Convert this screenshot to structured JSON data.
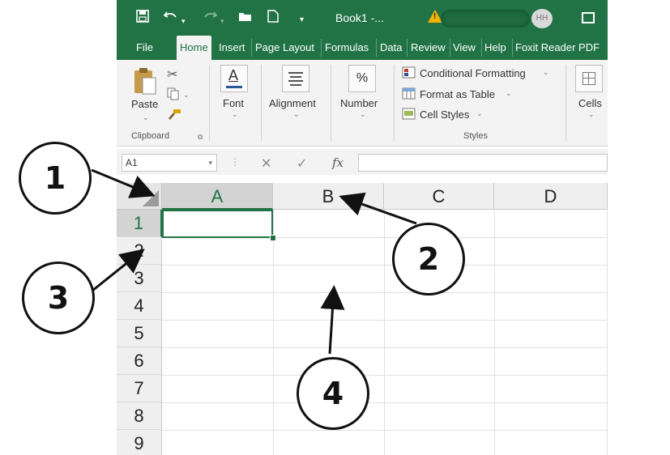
{
  "titlebar": {
    "title": "Book1 -...",
    "avatar_initials": "HH",
    "icons": [
      "save-icon",
      "undo-icon",
      "redo-icon",
      "open-folder-icon",
      "new-file-icon",
      "customize-icon",
      "warning-icon",
      "restore-icon"
    ]
  },
  "ribbon_tabs": [
    "File",
    "Home",
    "Insert",
    "Page Layout",
    "Formulas",
    "Data",
    "Review",
    "View",
    "Help",
    "Foxit Reader PDF"
  ],
  "active_tab": "Home",
  "ribbon": {
    "paste": "Paste",
    "clipboard": "Clipboard",
    "font": "Font",
    "alignment": "Alignment",
    "number": "Number",
    "number_icon": "%",
    "conditional_formatting": "Conditional Formatting",
    "format_as_table": "Format as Table",
    "cell_styles": "Cell Styles",
    "styles": "Styles",
    "cells": "Cells"
  },
  "formula_bar": {
    "name_box": "A1",
    "cancel": "✕",
    "enter": "✓",
    "fx": "fx"
  },
  "sheet": {
    "columns": [
      "A",
      "B",
      "C",
      "D"
    ],
    "rows": [
      "1",
      "2",
      "3",
      "4",
      "5",
      "6",
      "7",
      "8",
      "9"
    ],
    "active_cell": "A1"
  },
  "callouts": [
    "1",
    "2",
    "3",
    "4"
  ],
  "colors": {
    "excel_green": "#217346",
    "ribbon_bg": "#f3f3f3",
    "header_bg": "#efefef"
  }
}
